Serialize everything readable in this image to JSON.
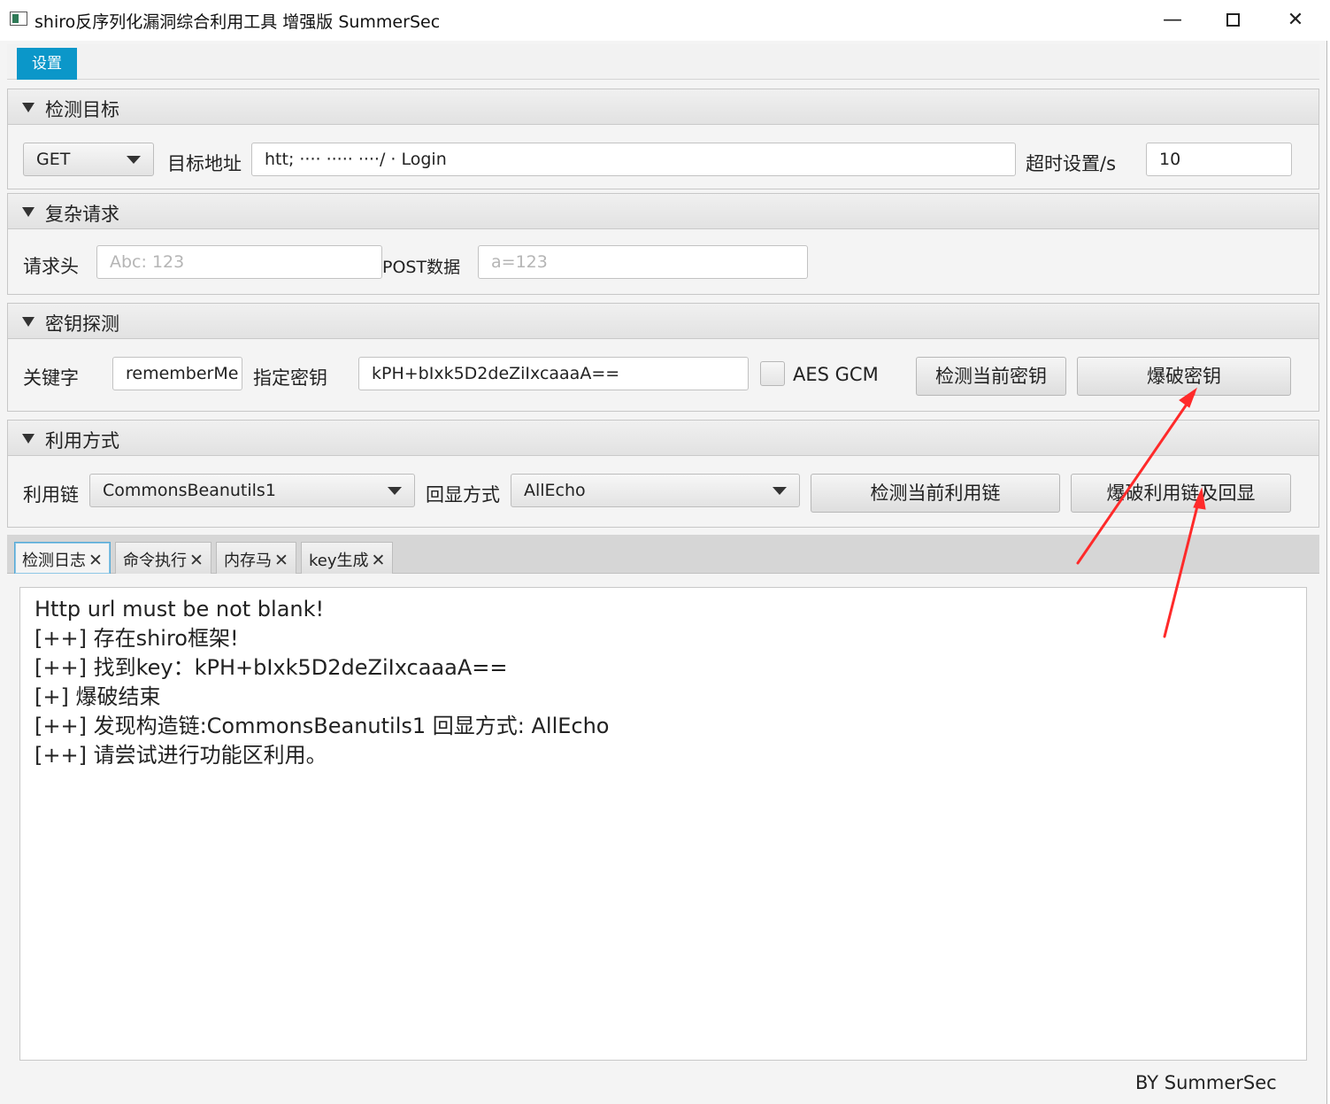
{
  "window": {
    "title": "shiro反序列化漏洞综合利用工具 增强版 SummerSec",
    "minimize_glyph": "—",
    "close_glyph": "✕"
  },
  "menu": {
    "settings": "设置"
  },
  "target_section": {
    "title": "检测目标",
    "method": "GET",
    "url_label": "目标地址",
    "url_value": "htt; ···· ····· ····/ · Login",
    "timeout_label": "超时设置/s",
    "timeout_value": "10"
  },
  "request_section": {
    "title": "复杂请求",
    "headers_label": "请求头",
    "headers_placeholder": "Abc: 123",
    "post_label": "POST数据",
    "post_placeholder": "a=123"
  },
  "key_section": {
    "title": "密钥探测",
    "keyword_label": "关键字",
    "keyword_value": "rememberMe",
    "key_label": "指定密钥",
    "key_value": "kPH+bIxk5D2deZiIxcaaaA==",
    "aes_gcm_label": "AES GCM",
    "detect_key_button": "检测当前密钥",
    "brute_key_button": "爆破密钥"
  },
  "exploit_section": {
    "title": "利用方式",
    "chain_label": "利用链",
    "chain_value": "CommonsBeanutils1",
    "echo_label": "回显方式",
    "echo_value": "AllEcho",
    "detect_chain_button": "检测当前利用链",
    "brute_chain_button": "爆破利用链及回显"
  },
  "tabs": [
    {
      "label": "检测日志"
    },
    {
      "label": "命令执行"
    },
    {
      "label": "内存马"
    },
    {
      "label": "key生成"
    }
  ],
  "tab_close_glyph": "✕",
  "log": [
    "Http url must be not blank!",
    "[++] 存在shiro框架!",
    "[++] 找到key：kPH+bIxk5D2deZiIxcaaaA==",
    "[+] 爆破结束",
    "[++] 发现构造链:CommonsBeanutils1  回显方式: AllEcho",
    "[++] 请尝试进行功能区利用。"
  ],
  "footer": "BY   SummerSec",
  "annotation_color": "#ff2a2a",
  "accent_color": "#0b97c9"
}
